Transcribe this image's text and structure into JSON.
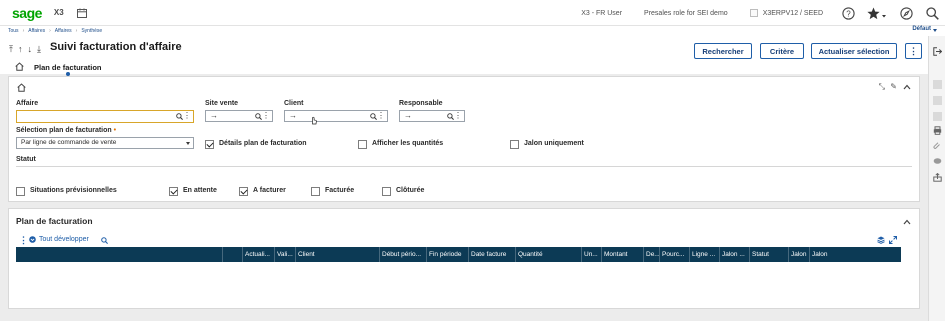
{
  "header": {
    "logo": "sage",
    "app_name": "X3",
    "user": "X3 - FR User",
    "role": "Presales role for SEI demo",
    "folder": "X3ERPV12 / SEED"
  },
  "breadcrumb": {
    "items": [
      "Tous",
      "Affaires",
      "Affaires",
      "Synthèse"
    ],
    "default_label": "Défaut"
  },
  "page": {
    "title": "Suivi facturation d'affaire",
    "tab": "Plan de facturation"
  },
  "actions": {
    "search": "Rechercher",
    "criteria": "Critère",
    "refresh": "Actualiser sélection"
  },
  "criteria": {
    "affaire_label": "Affaire",
    "affaire_value": "",
    "site_label": "Site vente",
    "client_label": "Client",
    "responsable_label": "Responsable",
    "selection_label": "Sélection plan de facturation",
    "selection_value": "Par ligne de commande de vente",
    "details_label": "Détails plan de facturation",
    "details_checked": true,
    "quantities_label": "Afficher les quantités",
    "quantities_checked": false,
    "milestone_label": "Jalon uniquement",
    "milestone_checked": false,
    "status_label": "Statut",
    "statuses": [
      {
        "label": "Situations prévisionnelles",
        "checked": false
      },
      {
        "label": "En attente",
        "checked": true
      },
      {
        "label": "A facturer",
        "checked": true
      },
      {
        "label": "Facturée",
        "checked": false
      },
      {
        "label": "Clôturée",
        "checked": false
      }
    ]
  },
  "grid": {
    "title": "Plan de facturation",
    "expand_all": "Tout développer",
    "columns": [
      "",
      "",
      "Actuali...",
      "Vali...",
      "Client",
      "Début pério...",
      "Fin période",
      "Date facture",
      "Quantité",
      "Un...",
      "Montant",
      "De...",
      "Pourc...",
      "Ligne ...",
      "Jalon ...",
      "Statut",
      "Jalon",
      "Jalon"
    ]
  },
  "colors": {
    "brand_green": "#00a400",
    "accent_blue": "#1f5ea8",
    "grid_header": "#0c3a55",
    "active_field": "#d8a62a"
  }
}
